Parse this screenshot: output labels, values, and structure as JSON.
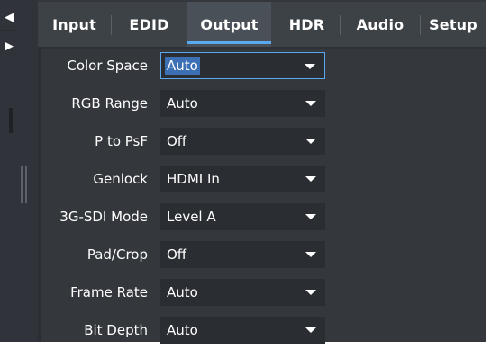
{
  "side_panel": {
    "collapse_icon": "triangle-left-icon",
    "expand_icon": "triangle-right-icon"
  },
  "tabs": [
    {
      "label": "Input",
      "active": false
    },
    {
      "label": "EDID",
      "active": false
    },
    {
      "label": "Output",
      "active": true
    },
    {
      "label": "HDR",
      "active": false
    },
    {
      "label": "Audio",
      "active": false
    },
    {
      "label": "Setup",
      "active": false
    }
  ],
  "settings": [
    {
      "label": "Color Space",
      "value": "Auto",
      "focused": true
    },
    {
      "label": "RGB Range",
      "value": "Auto"
    },
    {
      "label": "P to PsF",
      "value": "Off"
    },
    {
      "label": "Genlock",
      "value": "HDMI In"
    },
    {
      "label": "3G-SDI Mode",
      "value": "Level A"
    },
    {
      "label": "Pad/Crop",
      "value": "Off"
    },
    {
      "label": "Frame Rate",
      "value": "Auto"
    },
    {
      "label": "Bit Depth",
      "value": "Auto"
    }
  ],
  "colors": {
    "background": "#34383c",
    "tabbar": "#3d4247",
    "active_tab": "#4a5057",
    "accent": "#5aa8f0",
    "field": "#2a2e33",
    "selection": "#3d6fb4",
    "text": "#ffffff"
  }
}
